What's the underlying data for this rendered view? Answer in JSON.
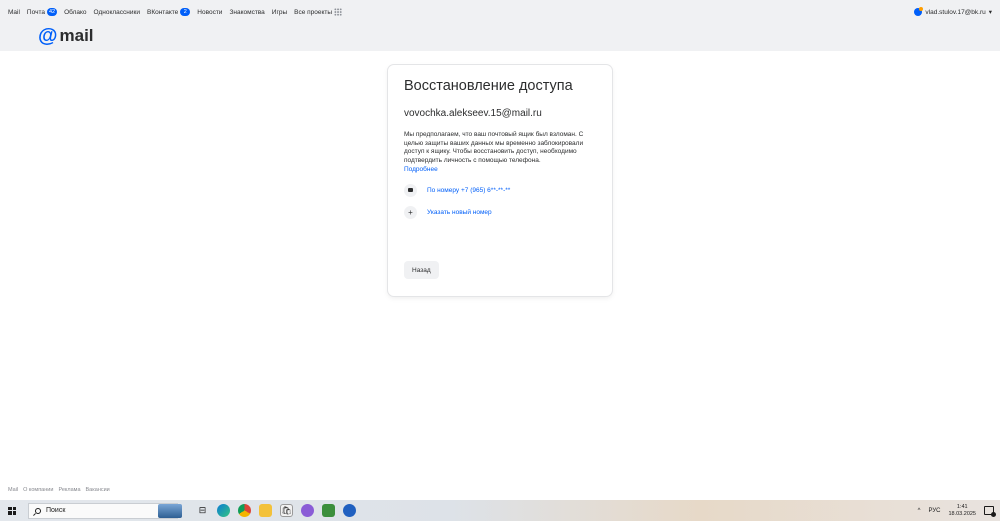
{
  "portal": {
    "links": [
      {
        "label": "Mail",
        "counter": ""
      },
      {
        "label": "Почта",
        "counter": "42"
      },
      {
        "label": "Облако",
        "counter": ""
      },
      {
        "label": "Одноклассники",
        "counter": ""
      },
      {
        "label": "ВКонтакте",
        "counter": "2"
      },
      {
        "label": "Новости",
        "counter": ""
      },
      {
        "label": "Знакомства",
        "counter": ""
      },
      {
        "label": "Игры",
        "counter": ""
      },
      {
        "label": "Все проекты",
        "counter": ""
      }
    ],
    "user_email": "vlad.stulov.17@bk.ru",
    "user_caret": "▾"
  },
  "header": {
    "logo_at": "@",
    "logo_text": "mail"
  },
  "card": {
    "title": "Восстановление доступа",
    "email": "vovochka.alekseev.15@mail.ru",
    "description": "Мы предполагаем, что ваш почтовый ящик был взломан. С целью защиты ваших данных мы временно заблокировали доступ к ящику. Чтобы восстановить доступ, необходимо подтвердить личность с помощью телефона.",
    "more_link": "Подробнее",
    "option_phone": "По номеру +7 (965) 6**-**-**",
    "option_new_number": "Указать новый номер",
    "option_new_icon": "+",
    "back_button": "Назад"
  },
  "footer": {
    "links": [
      "Mail",
      "О компании",
      "Реклама",
      "Вакансии"
    ]
  },
  "taskbar": {
    "search_placeholder": "Поиск",
    "language": "РУС",
    "tray_caret": "^",
    "time": "1:41",
    "date": "18.03.2025",
    "task_icons": [
      "task-view-icon",
      "edge-icon",
      "chrome-icon",
      "file-explorer-icon",
      "store-icon",
      "viber-icon",
      "package-icon",
      "chrome-profile-icon"
    ]
  }
}
